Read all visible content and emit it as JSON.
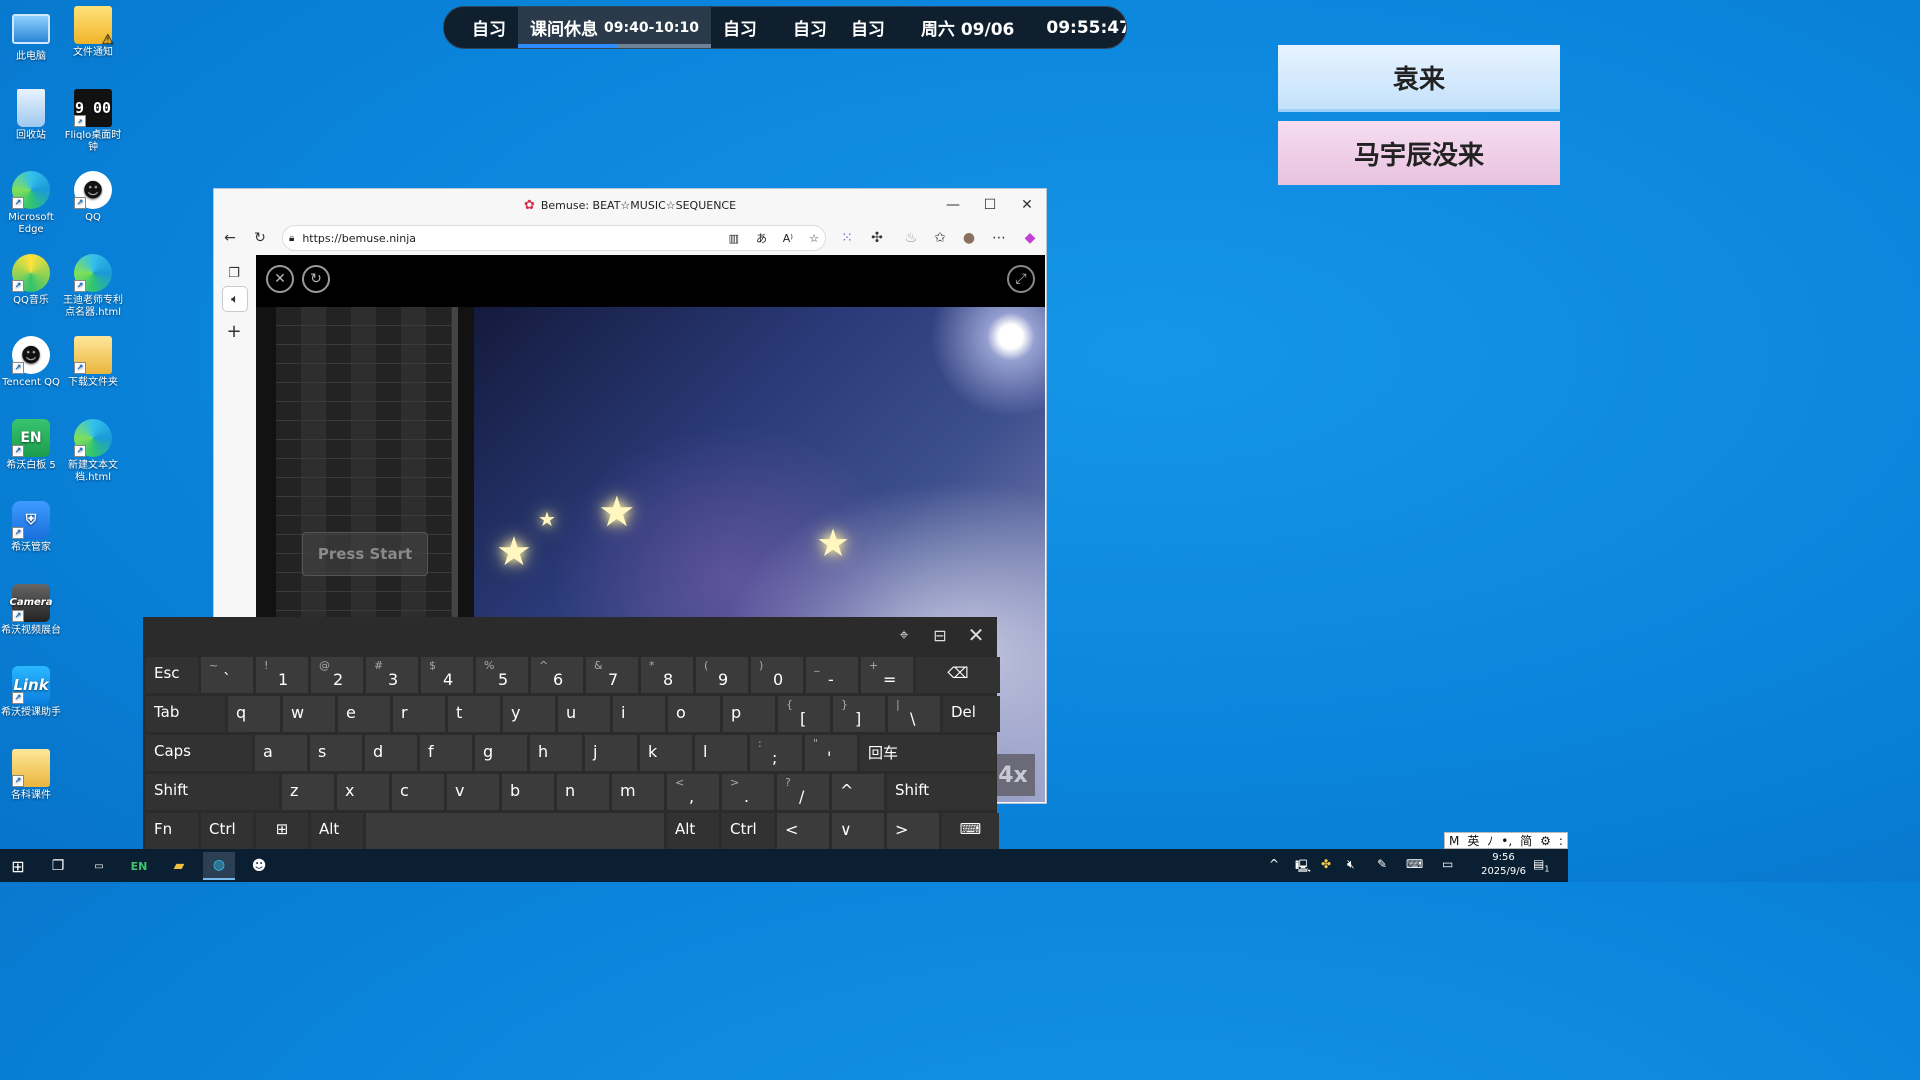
{
  "desktop_icons": [
    {
      "label": "此电脑",
      "icon": "computer-icon"
    },
    {
      "label": "文件通知",
      "icon": "folder-warning-icon"
    },
    {
      "label": "回收站",
      "icon": "recycle-bin-icon"
    },
    {
      "label": "Fliqlo桌面时钟",
      "icon": "clock-app-icon",
      "glyph": "9 00"
    },
    {
      "label": "Microsoft Edge",
      "icon": "edge-icon"
    },
    {
      "label": "QQ",
      "icon": "qq-icon"
    },
    {
      "label": "QQ音乐",
      "icon": "qq-music-icon"
    },
    {
      "label": "王迪老师专利点名器.html",
      "icon": "edge-html-icon"
    },
    {
      "label": "Tencent QQ",
      "icon": "qq-icon"
    },
    {
      "label": "下载文件夹",
      "icon": "folder-icon"
    },
    {
      "label": "希沃白板 5",
      "icon": "easinote-icon",
      "glyph": "EN"
    },
    {
      "label": "新建文本文档.html",
      "icon": "edge-html-icon"
    },
    {
      "label": "希沃管家",
      "icon": "shield-app-icon"
    },
    {
      "label": "希沃视频展台",
      "icon": "camera-app-icon",
      "glyph": "Camera"
    },
    {
      "label": "希沃授课助手",
      "icon": "link-app-icon",
      "glyph": "Link"
    },
    {
      "label": "各科课件",
      "icon": "folder-files-icon"
    }
  ],
  "schedule": {
    "items": [
      "自习",
      "课间休息",
      "自习",
      "自习",
      "自习"
    ],
    "active_time_range": "09:40-10:10",
    "active_progress": 0.52,
    "date": "周六 09/06",
    "clock": "09:55:47"
  },
  "attendance": [
    "袁来",
    "马宇辰没来"
  ],
  "browser": {
    "title": "Bemuse: BEAT☆MUSIC☆SEQUENCE",
    "url": "https://bemuse.ninja",
    "press_start": "Press Start",
    "speed": "4x"
  },
  "keyboard": {
    "row1": [
      {
        "main": "Esc"
      },
      {
        "sub": "~",
        "num": "`"
      },
      {
        "sub": "!",
        "num": "1"
      },
      {
        "sub": "@",
        "num": "2"
      },
      {
        "sub": "#",
        "num": "3"
      },
      {
        "sub": "$",
        "num": "4"
      },
      {
        "sub": "%",
        "num": "5"
      },
      {
        "sub": "^",
        "num": "6"
      },
      {
        "sub": "&",
        "num": "7"
      },
      {
        "sub": "*",
        "num": "8"
      },
      {
        "sub": "(",
        "num": "9"
      },
      {
        "sub": ")",
        "num": "0"
      },
      {
        "sub": "_",
        "num": "-"
      },
      {
        "sub": "+",
        "num": "="
      },
      {
        "main": "⌫"
      }
    ],
    "row2": [
      {
        "main": "Tab"
      },
      {
        "main": "q"
      },
      {
        "main": "w"
      },
      {
        "main": "e"
      },
      {
        "main": "r"
      },
      {
        "main": "t"
      },
      {
        "main": "y"
      },
      {
        "main": "u"
      },
      {
        "main": "i"
      },
      {
        "main": "o"
      },
      {
        "main": "p"
      },
      {
        "sub": "{",
        "num": "["
      },
      {
        "sub": "}",
        "num": "]"
      },
      {
        "sub": "|",
        "num": "\\"
      },
      {
        "main": "Del"
      }
    ],
    "row3": [
      {
        "main": "Caps"
      },
      {
        "main": "a"
      },
      {
        "main": "s"
      },
      {
        "main": "d"
      },
      {
        "main": "f"
      },
      {
        "main": "g"
      },
      {
        "main": "h"
      },
      {
        "main": "j"
      },
      {
        "main": "k"
      },
      {
        "main": "l"
      },
      {
        "sub": ":",
        "num": ";"
      },
      {
        "sub": "\"",
        "num": "'"
      },
      {
        "main": "回车"
      }
    ],
    "row4": [
      {
        "main": "Shift"
      },
      {
        "main": "z"
      },
      {
        "main": "x"
      },
      {
        "main": "c"
      },
      {
        "main": "v"
      },
      {
        "main": "b"
      },
      {
        "main": "n"
      },
      {
        "main": "m"
      },
      {
        "sub": "<",
        "num": ","
      },
      {
        "sub": ">",
        "num": "."
      },
      {
        "sub": "?",
        "num": "/"
      },
      {
        "main": "^"
      },
      {
        "main": "Shift"
      }
    ],
    "row5": [
      {
        "main": "Fn"
      },
      {
        "main": "Ctrl"
      },
      {
        "main": "⊞"
      },
      {
        "main": "Alt"
      },
      {
        "main": ""
      },
      {
        "main": "Alt"
      },
      {
        "main": "Ctrl"
      },
      {
        "main": "<"
      },
      {
        "main": "∨"
      },
      {
        "main": ">"
      },
      {
        "main": "⌨"
      }
    ]
  },
  "ime_bar": [
    "M",
    "英",
    "ﾉ",
    "•,",
    "简",
    "⚙",
    ":"
  ],
  "taskbar": {
    "time": "9:56",
    "date": "2025/9/6",
    "notification_count": "1"
  }
}
